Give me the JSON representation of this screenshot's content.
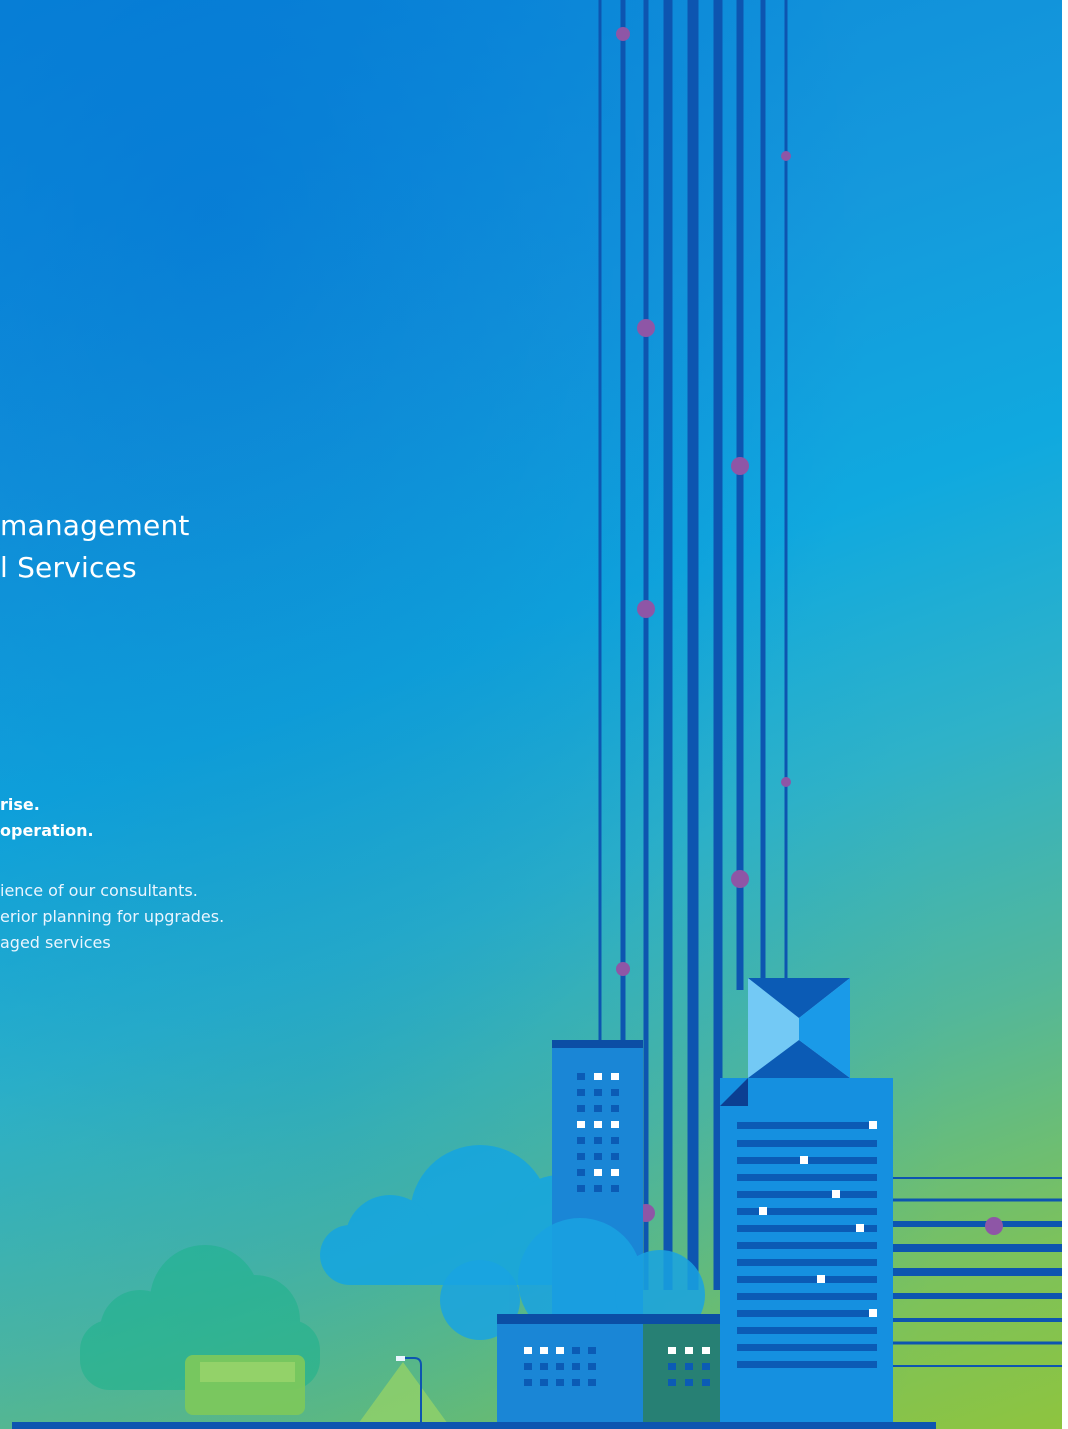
{
  "heading": {
    "line1": "management",
    "line2": "l Services"
  },
  "bold_lines": [
    "rise.",
    "operation."
  ],
  "light_lines": [
    "ience of our consultants.",
    "erior planning for upgrades.",
    "aged services"
  ],
  "colors": {
    "background_top": "#0a86d8",
    "background_bottom": "#8ec43f",
    "line_blue": "#0d55b0",
    "node_purple": "#8e56a6",
    "building_blue": "#1a86d6",
    "building_dark": "#0b4ea5",
    "cloud": "#16a8e0"
  },
  "icons": {
    "tower": "skyscraper-illustration",
    "clouds": "cloud-illustration",
    "vehicle": "bus-illustration",
    "lamp": "street-lamp-illustration"
  }
}
